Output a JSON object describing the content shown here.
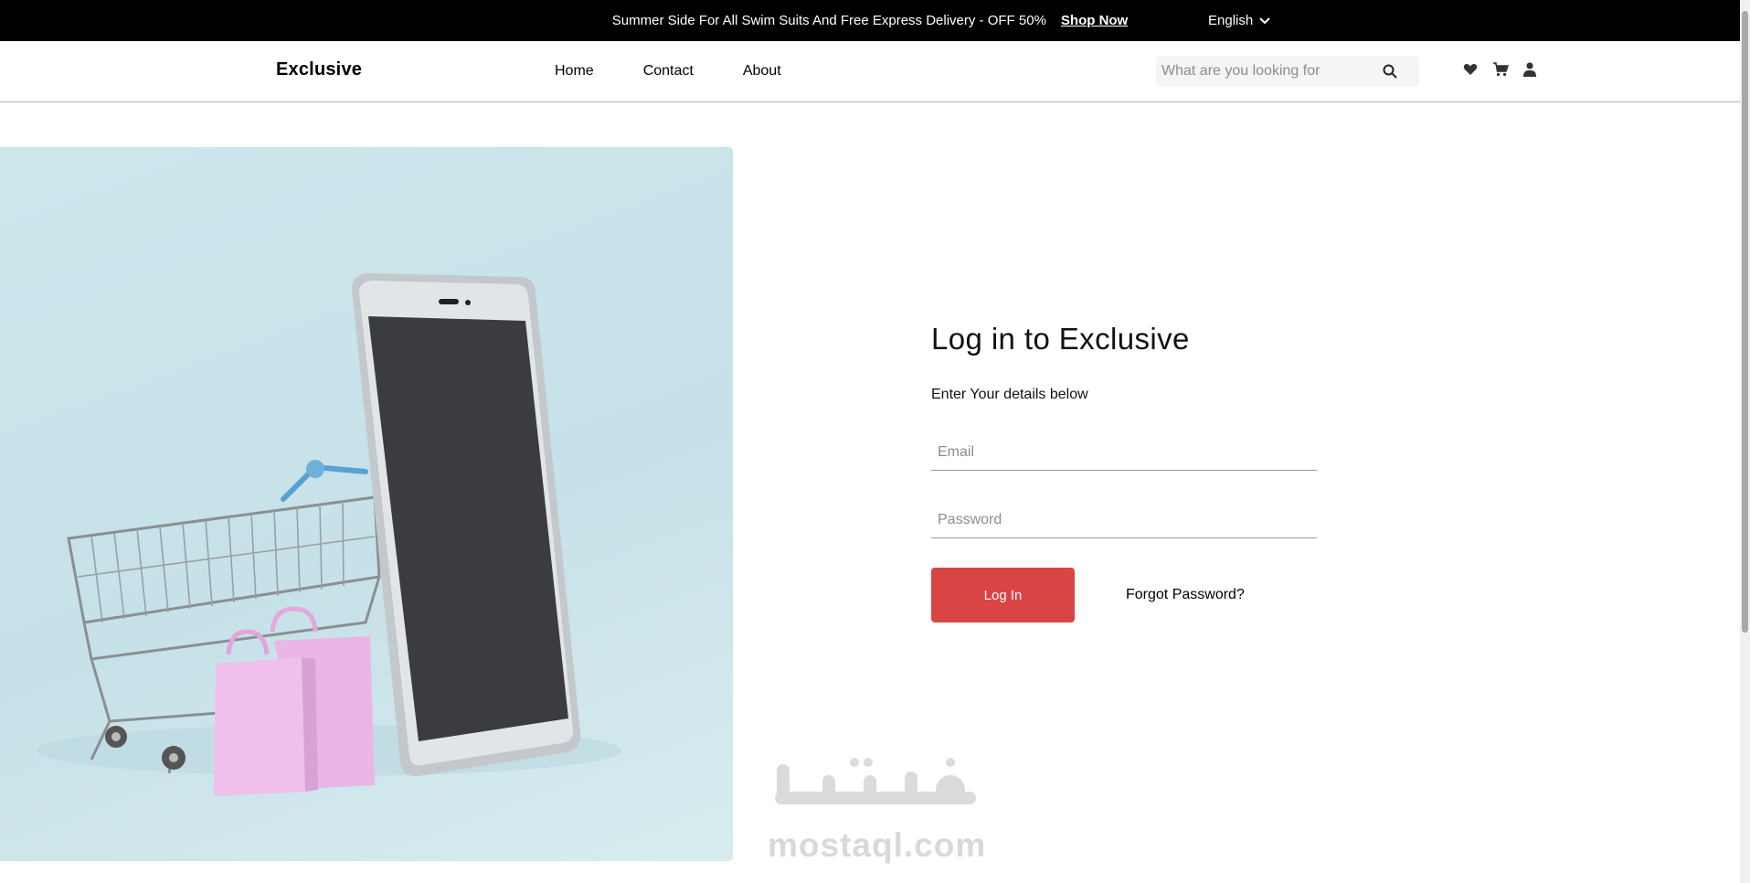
{
  "topbar": {
    "promo_text": "Summer Side For All Swim Suits And Free Express Delivery - OFF 50%",
    "shop_link": "Shop Now",
    "language": "English"
  },
  "header": {
    "logo": "Exclusive",
    "nav": [
      "Home",
      "Contact",
      "About"
    ],
    "search_placeholder": "What are you looking for",
    "icons": [
      "heart-icon",
      "cart-icon",
      "user-icon"
    ]
  },
  "login": {
    "title": "Log in to Exclusive",
    "subtitle": "Enter Your details below",
    "email_placeholder": "Email",
    "password_placeholder": "Password",
    "login_button": "Log In",
    "forgot_link": "Forgot Password?"
  },
  "watermark": {
    "arabic": "مستقل",
    "latin": "mostaql.com"
  },
  "colors": {
    "accent": "#db4444",
    "topbar_bg": "#000000",
    "hero_bg": "#c9e3ea"
  }
}
